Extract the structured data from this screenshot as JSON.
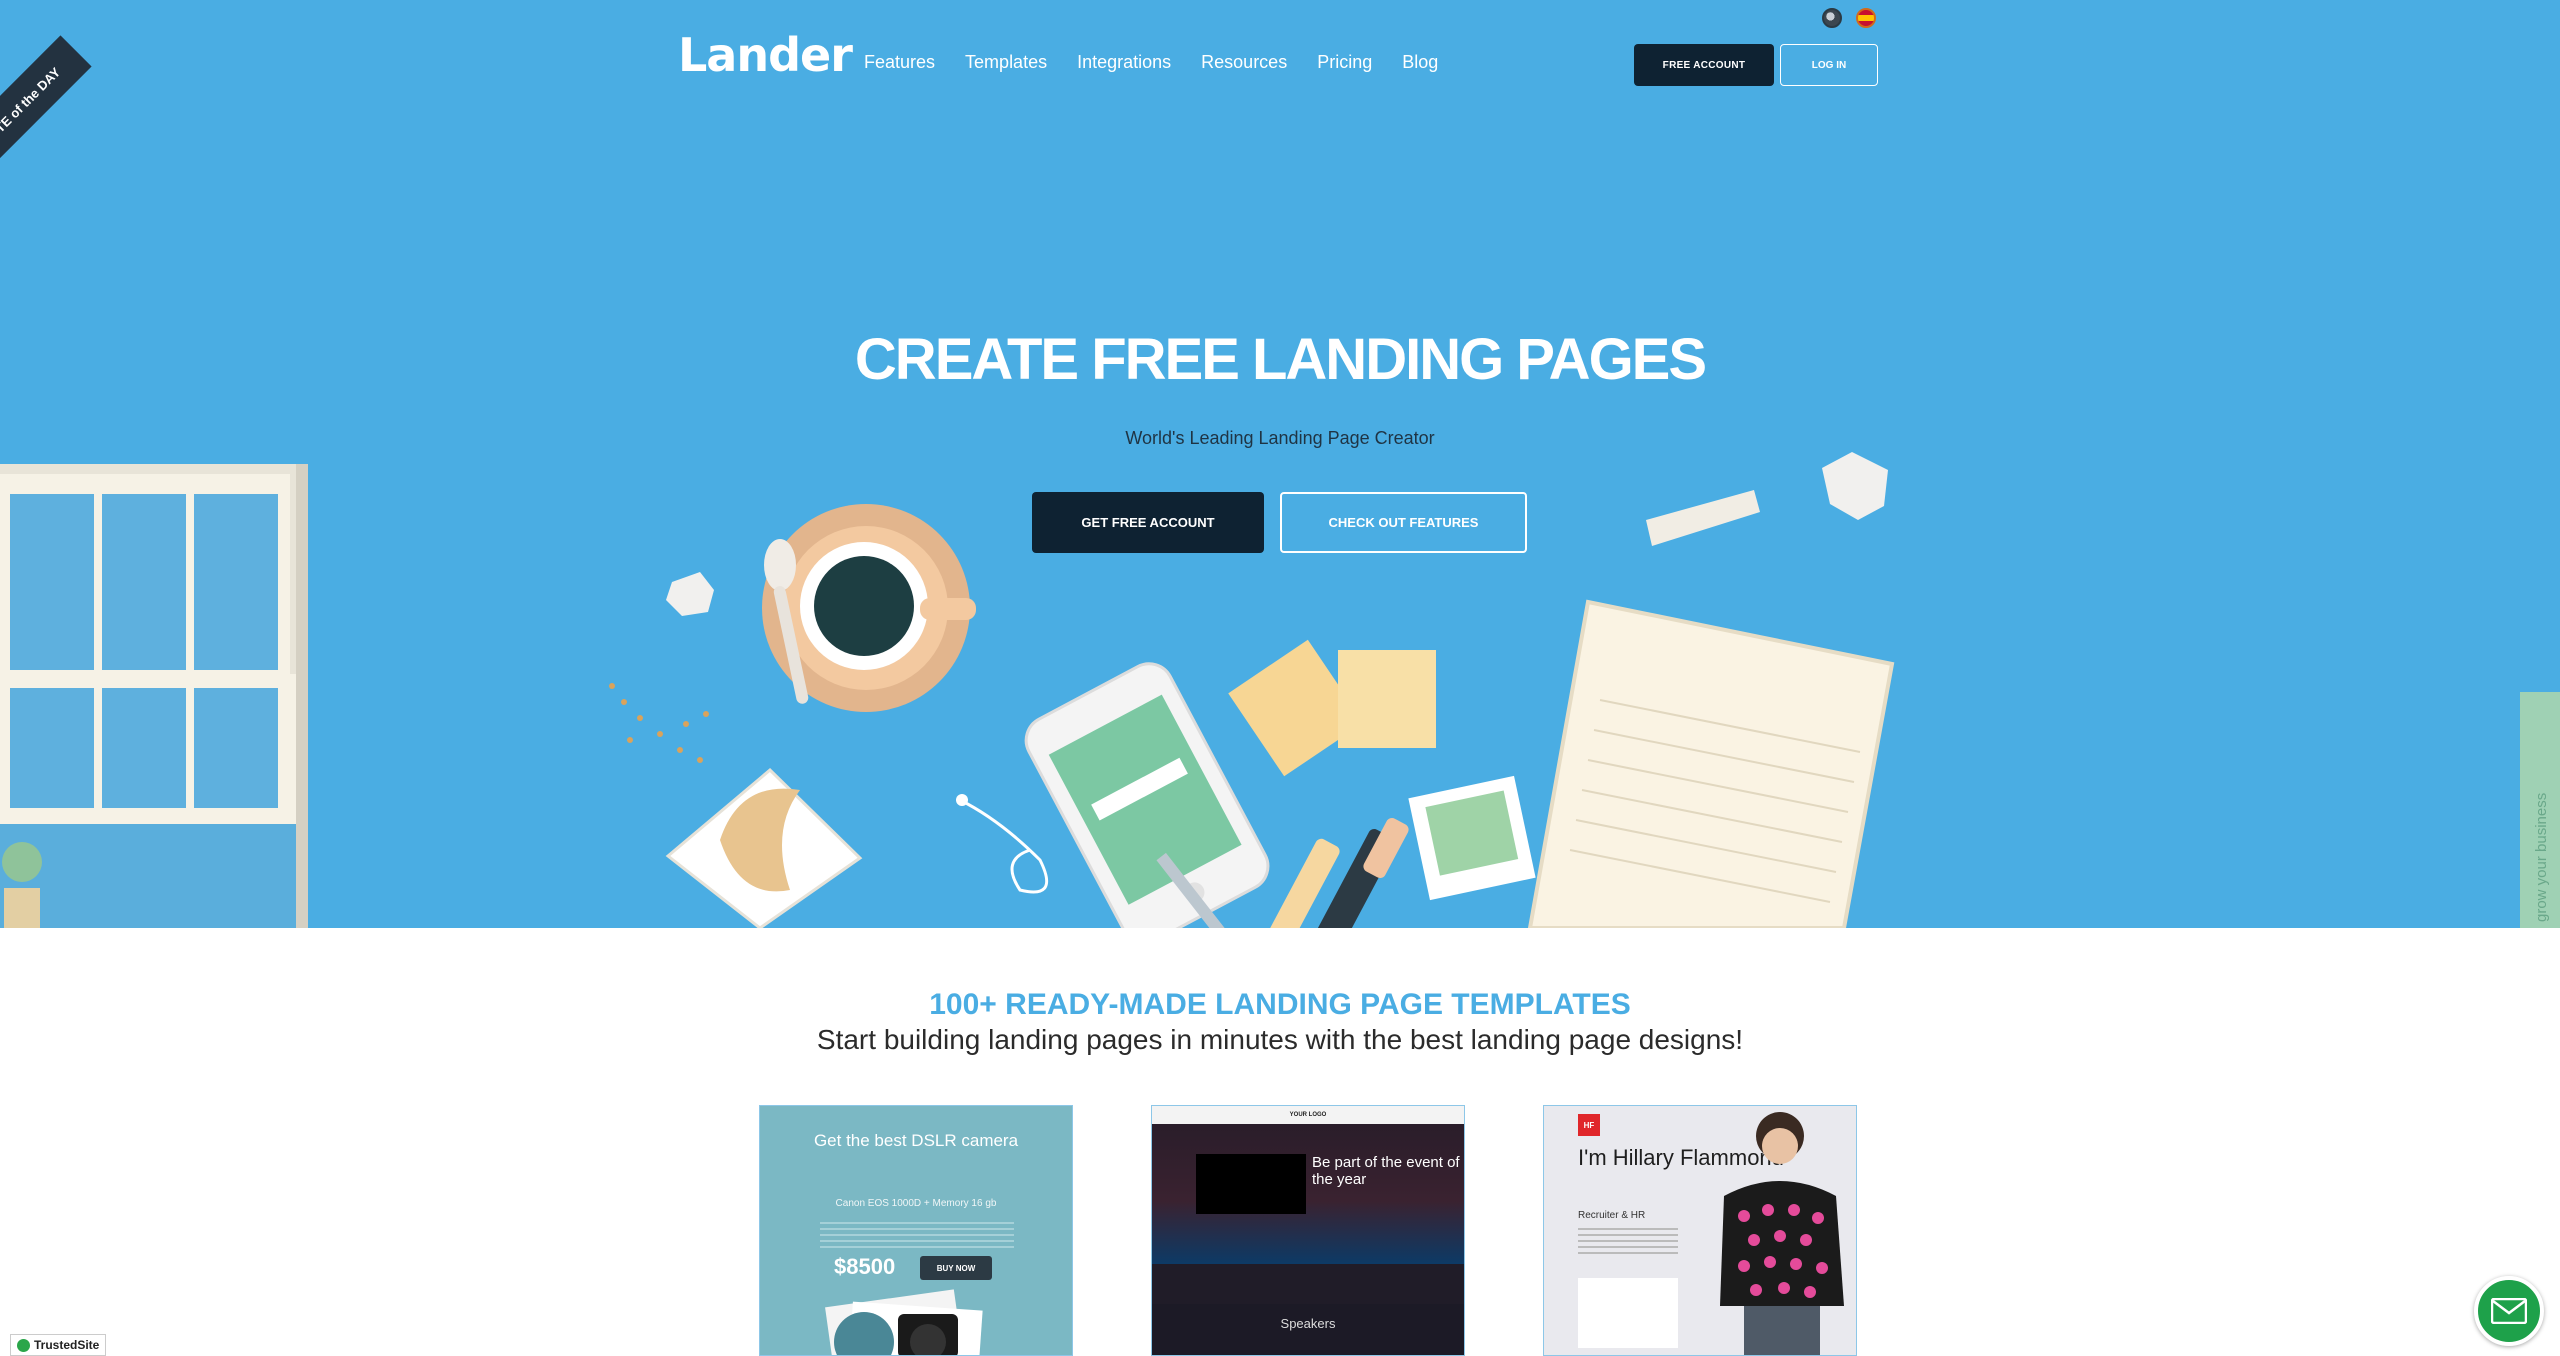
{
  "brand": {
    "logo_text": "Lander"
  },
  "nav": {
    "items": [
      "Features",
      "Templates",
      "Integrations",
      "Resources",
      "Pricing",
      "Blog"
    ]
  },
  "top_actions": {
    "free_account": "FREE ACCOUNT",
    "log_in": "LOG IN"
  },
  "badge": {
    "site_of_the_day": "SITE of the DAY"
  },
  "hero": {
    "title": "CREATE FREE LANDING PAGES",
    "subtitle": "World's Leading Landing Page Creator",
    "btn_primary": "GET FREE ACCOUNT",
    "btn_secondary": "CHECK OUT FEATURES"
  },
  "side_tab": {
    "text": "grow your business"
  },
  "templates": {
    "title": "100+ READY-MADE LANDING PAGE TEMPLATES",
    "subtitle": "Start building landing pages in minutes with the best landing page designs!",
    "cards": [
      {
        "headline": "Get the best DSLR camera",
        "subline": "Canon EOS 1000D + Memory 16 gb",
        "price": "$8500",
        "buy": "BUY NOW"
      },
      {
        "logo": "YOUR LOGO",
        "headline": "Be part of the event of the year",
        "section": "Speakers"
      },
      {
        "badge": "HF",
        "name": "I'm Hillary Flammond",
        "role": "Recruiter & HR"
      }
    ]
  },
  "footer": {
    "trusted": "TrustedSite"
  },
  "colors": {
    "hero_bg": "#4aade3",
    "dark_button": "#0e2232",
    "accent_title": "#4aade3",
    "chat_button": "#1ea14a"
  },
  "icons": {
    "language_us": "us-flag-icon",
    "language_es": "es-flag-icon",
    "mail": "envelope-icon",
    "trusted": "check-shield-icon"
  }
}
